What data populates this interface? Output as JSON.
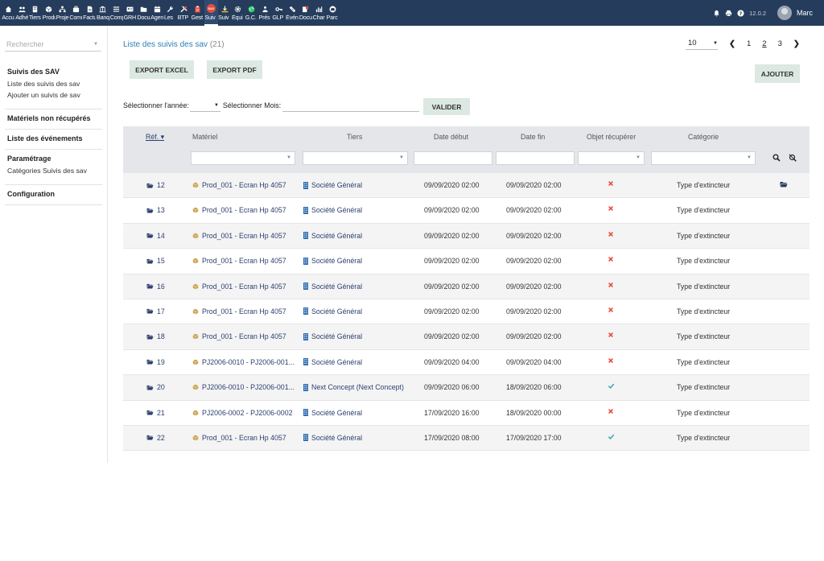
{
  "topbar": {
    "menu": [
      {
        "label": "Accu",
        "icon": "home-icon"
      },
      {
        "label": "Adhé",
        "icon": "users-icon"
      },
      {
        "label": "Tiers",
        "icon": "building-icon"
      },
      {
        "label": "Produ",
        "icon": "cube-icon"
      },
      {
        "label": "Proje",
        "icon": "sitemap-icon"
      },
      {
        "label": "Comm",
        "icon": "briefcase-icon"
      },
      {
        "label": "Factu",
        "icon": "file-invoice-icon"
      },
      {
        "label": "Banq",
        "icon": "bank-icon"
      },
      {
        "label": "Comp",
        "icon": "bars-icon"
      },
      {
        "label": "GRH",
        "icon": "id-card-icon"
      },
      {
        "label": "Docu",
        "icon": "folder-icon"
      },
      {
        "label": "Agen",
        "icon": "calendar-icon"
      },
      {
        "label": "Les",
        "icon": "wrench-icon"
      },
      {
        "label": "BTP",
        "icon": "tools-icon"
      },
      {
        "label": "Gest",
        "icon": "clipboard-icon"
      },
      {
        "label": "Suiv",
        "icon": "sav-badge-icon",
        "active": true
      },
      {
        "label": "Suiv",
        "icon": "download-icon"
      },
      {
        "label": "Équi",
        "icon": "gear-icon"
      },
      {
        "label": "G.C.",
        "icon": "globe-icon"
      },
      {
        "label": "Prés",
        "icon": "people-icon"
      },
      {
        "label": "GLP",
        "icon": "key-icon"
      },
      {
        "label": "Évén",
        "icon": "ticket-icon"
      },
      {
        "label": "Docu",
        "icon": "doc-icon"
      },
      {
        "label": "Char",
        "icon": "chart-icon"
      },
      {
        "label": "Parc",
        "icon": "car-icon"
      }
    ],
    "version": "12.0.2",
    "user": "Marc"
  },
  "sidebar": {
    "search_placeholder": "Rechercher",
    "sections": [
      {
        "title": "Suivis des SAV",
        "links": [
          "Liste des suivis des sav",
          "Ajouter un suivis de sav"
        ]
      },
      {
        "title": "Matériels non récupérés",
        "links": []
      },
      {
        "title": "Liste des événements",
        "links": []
      },
      {
        "title": "Paramétrage",
        "links": [
          "Catégories Suivis des sav"
        ]
      },
      {
        "title": "Configuration",
        "links": []
      }
    ]
  },
  "main": {
    "title": "Liste des suivis des sav",
    "count": "(21)",
    "limit": "10",
    "pages": [
      "1",
      "2",
      "3"
    ],
    "current_page": "2",
    "export_excel": "EXPORT EXCEL",
    "export_pdf": "EXPORT PDF",
    "add_label": "AJOUTER",
    "year_label": "Sélectionner l'année:",
    "month_label": "Sélectionner Mois:",
    "validate_label": "VALIDER",
    "columns": {
      "ref": "Réf.",
      "materiel": "Matériel",
      "tiers": "Tiers",
      "date_debut": "Date début",
      "date_fin": "Date fin",
      "objet": "Objet récupérer",
      "categorie": "Catégorie"
    },
    "rows": [
      {
        "ref": "12",
        "materiel": "Prod_001 - Ecran Hp 4057",
        "tiers": "Société Général",
        "debut": "09/09/2020 02:00",
        "fin": "09/09/2020 02:00",
        "recupere": false,
        "categorie": "Type d'extincteur"
      },
      {
        "ref": "13",
        "materiel": "Prod_001 - Ecran Hp 4057",
        "tiers": "Société Général",
        "debut": "09/09/2020 02:00",
        "fin": "09/09/2020 02:00",
        "recupere": false,
        "categorie": "Type d'extincteur"
      },
      {
        "ref": "14",
        "materiel": "Prod_001 - Ecran Hp 4057",
        "tiers": "Société Général",
        "debut": "09/09/2020 02:00",
        "fin": "09/09/2020 02:00",
        "recupere": false,
        "categorie": "Type d'extincteur"
      },
      {
        "ref": "15",
        "materiel": "Prod_001 - Ecran Hp 4057",
        "tiers": "Société Général",
        "debut": "09/09/2020 02:00",
        "fin": "09/09/2020 02:00",
        "recupere": false,
        "categorie": "Type d'extincteur"
      },
      {
        "ref": "16",
        "materiel": "Prod_001 - Ecran Hp 4057",
        "tiers": "Société Général",
        "debut": "09/09/2020 02:00",
        "fin": "09/09/2020 02:00",
        "recupere": false,
        "categorie": "Type d'extincteur"
      },
      {
        "ref": "17",
        "materiel": "Prod_001 - Ecran Hp 4057",
        "tiers": "Société Général",
        "debut": "09/09/2020 02:00",
        "fin": "09/09/2020 02:00",
        "recupere": false,
        "categorie": "Type d'extincteur"
      },
      {
        "ref": "18",
        "materiel": "Prod_001 - Ecran Hp 4057",
        "tiers": "Société Général",
        "debut": "09/09/2020 02:00",
        "fin": "09/09/2020 02:00",
        "recupere": false,
        "categorie": "Type d'extincteur"
      },
      {
        "ref": "19",
        "materiel": "PJ2006-0010 - PJ2006-001...",
        "tiers": "Société Général",
        "debut": "09/09/2020 04:00",
        "fin": "09/09/2020 04:00",
        "recupere": false,
        "categorie": "Type d'extincteur"
      },
      {
        "ref": "20",
        "materiel": "PJ2006-0010 - PJ2006-001...",
        "tiers": "Next Concept (Next Concept)",
        "debut": "09/09/2020 06:00",
        "fin": "18/09/2020 06:00",
        "recupere": true,
        "categorie": "Type d'extincteur"
      },
      {
        "ref": "21",
        "materiel": "PJ2006-0002 - PJ2006-0002",
        "tiers": "Société Général",
        "debut": "17/09/2020 16:00",
        "fin": "18/09/2020 00:00",
        "recupere": false,
        "categorie": "Type d'extincteur"
      },
      {
        "ref": "22",
        "materiel": "Prod_001 - Ecran Hp 4057",
        "tiers": "Société Général",
        "debut": "17/09/2020 08:00",
        "fin": "17/09/2020 17:00",
        "recupere": true,
        "categorie": "Type d'extincteur"
      }
    ]
  },
  "colors": {
    "topbar": "#263c5c",
    "link": "#2b3f6b",
    "title": "#2b7fb3",
    "button_bg": "#dce8e2",
    "cross": "#e74c3c",
    "check": "#3aa9b5"
  }
}
